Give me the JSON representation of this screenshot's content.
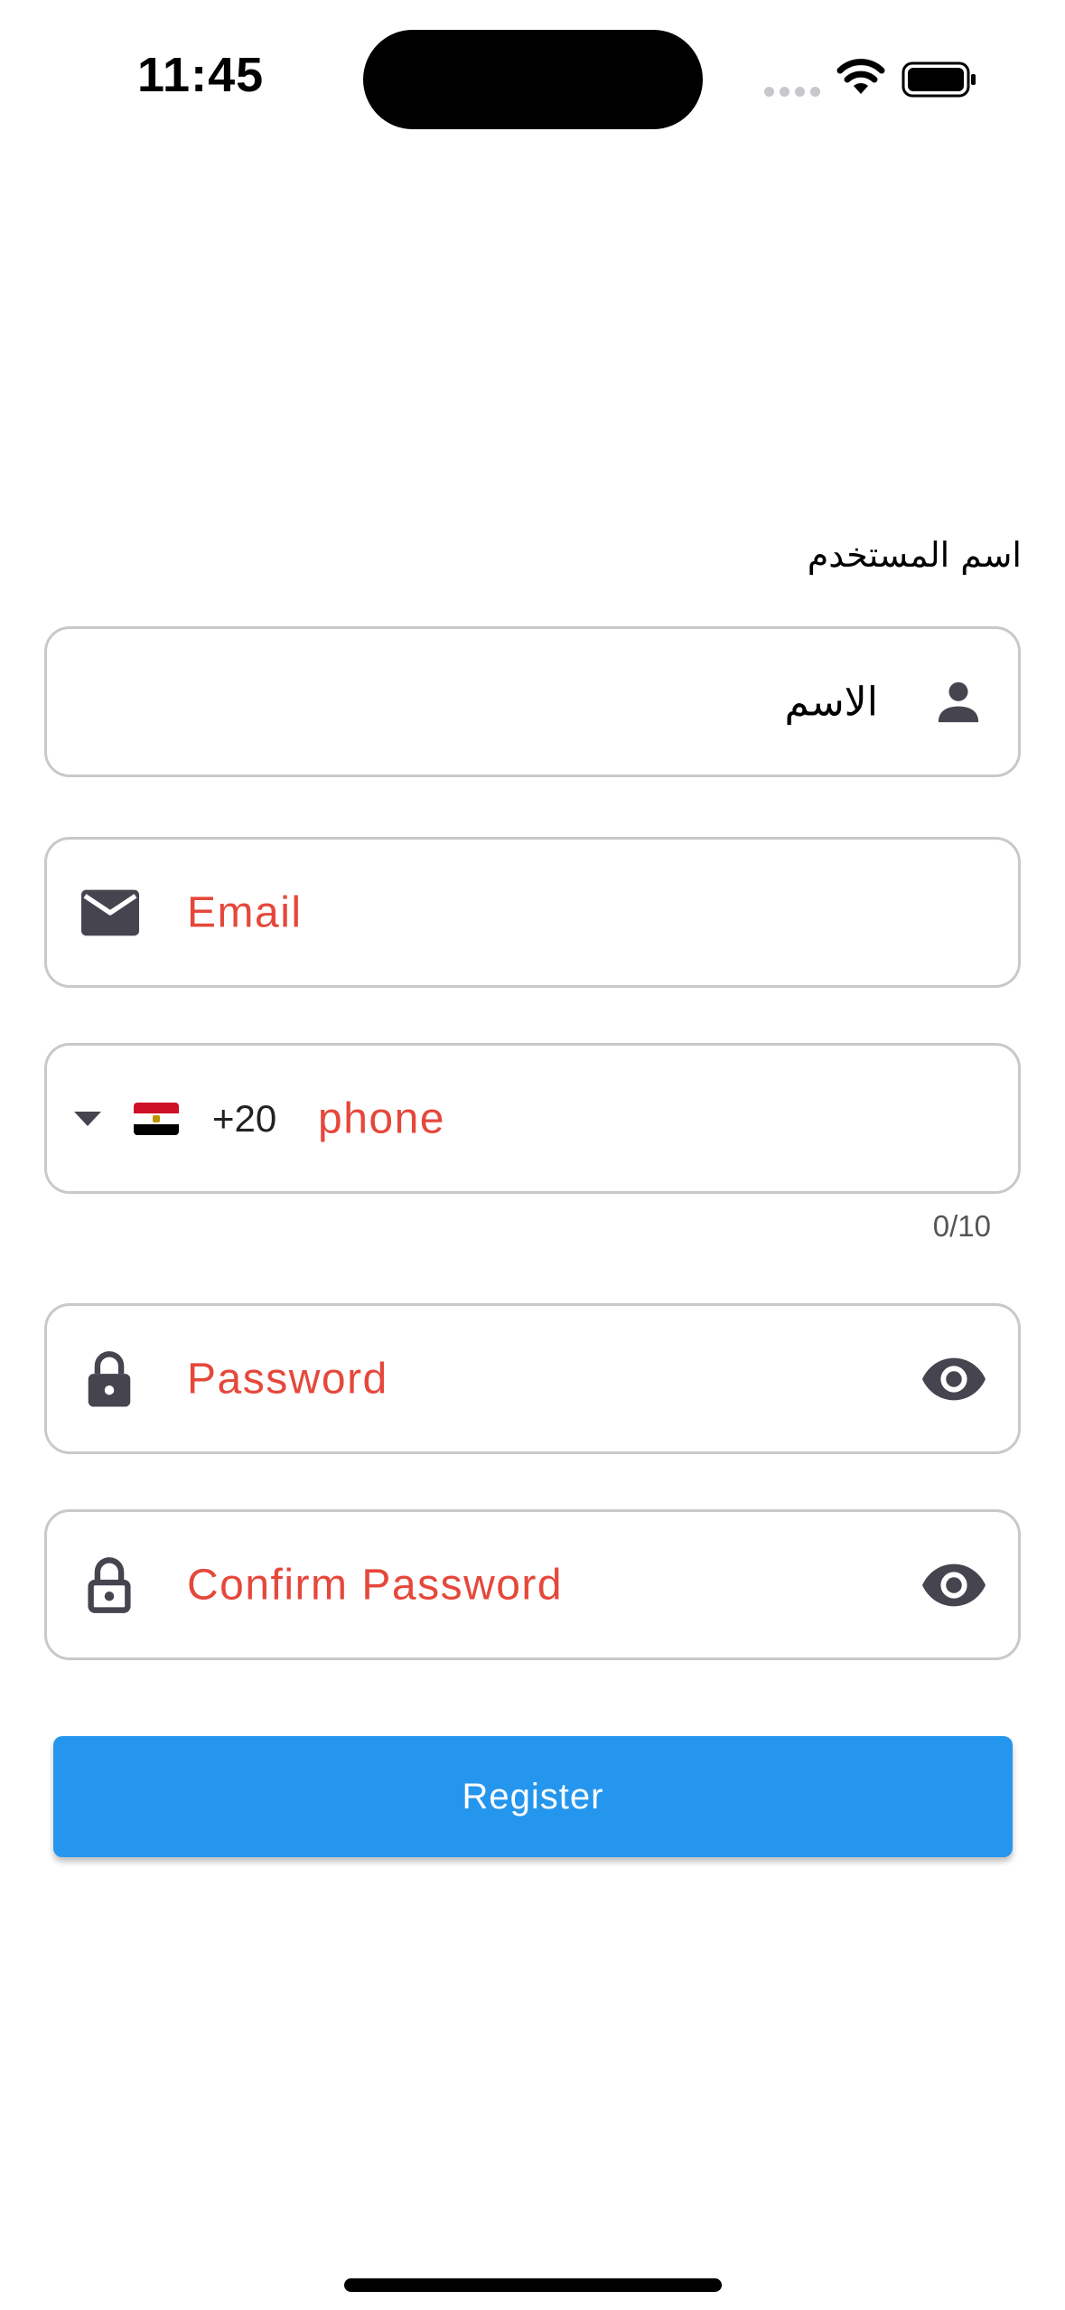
{
  "status_bar": {
    "time": "11:45"
  },
  "form": {
    "username_label": "اسم المستخدم",
    "name_field": {
      "value": "الاسم",
      "icon": "person-icon"
    },
    "email_field": {
      "placeholder": "Email",
      "icon": "mail-icon"
    },
    "phone_field": {
      "country_flag": "egypt-flag",
      "country_code": "+20",
      "placeholder": "phone",
      "counter": "0/10",
      "icon": "dropdown-arrow-icon"
    },
    "password_field": {
      "placeholder": "Password",
      "icon": "lock-icon",
      "trailing_icon": "eye-icon"
    },
    "confirm_password_field": {
      "placeholder": "Confirm Password",
      "icon": "lock-outline-icon",
      "trailing_icon": "eye-icon"
    },
    "register_label": "Register"
  },
  "colors": {
    "accent": "#2596ee",
    "placeholder": "#e5483b",
    "border": "#c9c9c9",
    "icon": "#46444f"
  }
}
